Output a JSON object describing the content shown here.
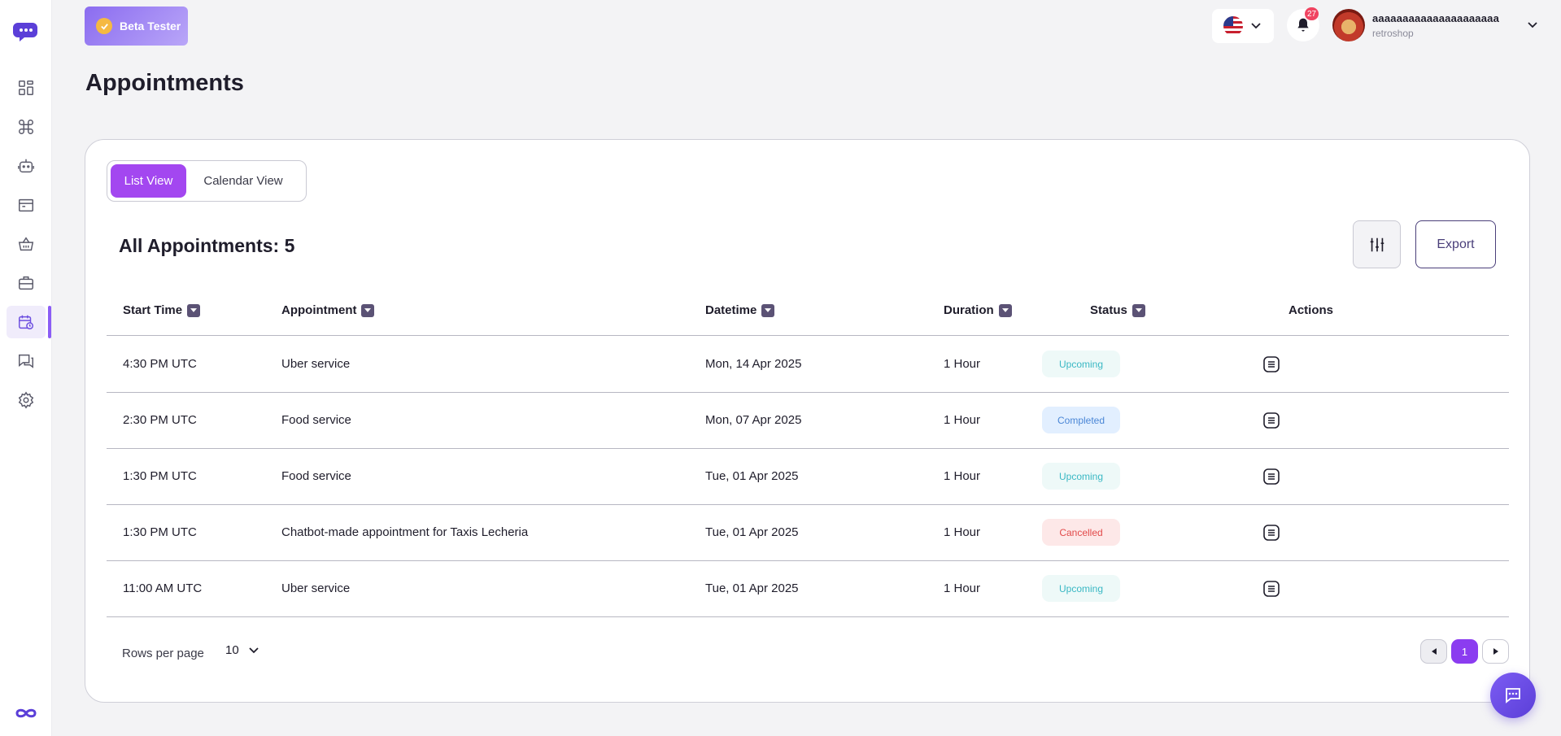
{
  "sidebar": {
    "items": [
      {
        "icon": "dashboard-icon"
      },
      {
        "icon": "command-icon"
      },
      {
        "icon": "bot-icon"
      },
      {
        "icon": "store-icon"
      },
      {
        "icon": "basket-icon"
      },
      {
        "icon": "briefcase-icon"
      },
      {
        "icon": "calendar-clock-icon",
        "active": true
      },
      {
        "icon": "chat-icon"
      },
      {
        "icon": "settings-icon"
      }
    ],
    "accent": "#8b5cf6"
  },
  "header": {
    "badge_label": "Beta Tester",
    "notifications_count": "27",
    "user_name": "aaaaaaaaaaaaaaaaaaaaa",
    "user_shop": "retroshop"
  },
  "page": {
    "title": "Appointments"
  },
  "view_toggle": {
    "list_label": "List View",
    "calendar_label": "Calendar View"
  },
  "summary": {
    "label": "All Appointments: 5"
  },
  "toolbar": {
    "export_label": "Export"
  },
  "table": {
    "columns": [
      "Start Time",
      "Appointment",
      "Datetime",
      "Duration",
      "Status",
      "Actions"
    ],
    "rows": [
      {
        "start": "4:30 PM UTC",
        "appointment": "Uber service",
        "datetime": "Mon, 14 Apr 2025",
        "duration": "1 Hour",
        "status": "Upcoming"
      },
      {
        "start": "2:30 PM UTC",
        "appointment": "Food service",
        "datetime": "Mon, 07 Apr 2025",
        "duration": "1 Hour",
        "status": "Completed"
      },
      {
        "start": "1:30 PM UTC",
        "appointment": "Food service",
        "datetime": "Tue, 01 Apr 2025",
        "duration": "1 Hour",
        "status": "Upcoming"
      },
      {
        "start": "1:30 PM UTC",
        "appointment": "Chatbot-made appointment for Taxis Lecheria",
        "datetime": "Tue, 01 Apr 2025",
        "duration": "1 Hour",
        "status": "Cancelled"
      },
      {
        "start": "11:00 AM UTC",
        "appointment": "Uber service",
        "datetime": "Tue, 01 Apr 2025",
        "duration": "1 Hour",
        "status": "Upcoming"
      }
    ]
  },
  "pagination": {
    "rows_label": "Rows per page",
    "rows_value": "10",
    "current_page": "1"
  },
  "colors": {
    "primary": "#a347f0",
    "upcoming": "#3ab8c4",
    "completed": "#4a86d6",
    "cancelled": "#e24a4a"
  }
}
